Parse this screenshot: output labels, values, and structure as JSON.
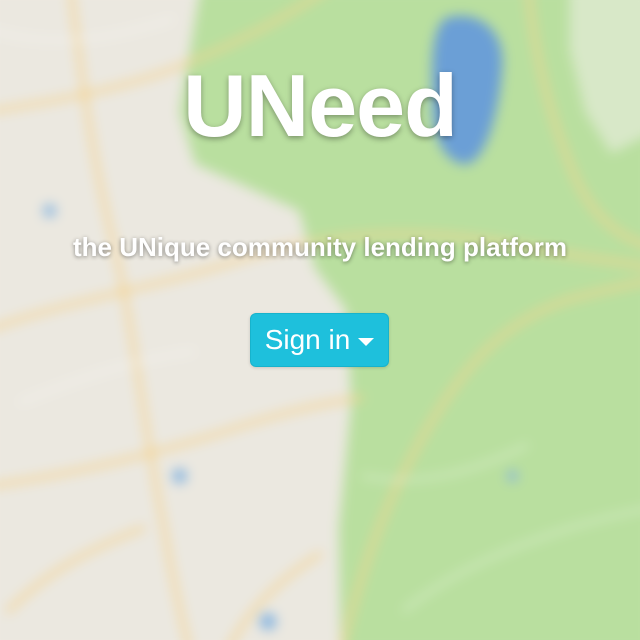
{
  "hero": {
    "brand": "UNeed",
    "tagline": "the UNique community lending platform",
    "signin_label": "Sign in",
    "signin_icon": "caret-down-icon"
  },
  "colors": {
    "button_bg": "#1ec0dc",
    "map_green": "#b9df9f",
    "map_land": "#ebe8e0",
    "map_water": "#6b9fd6",
    "map_road": "#f5d38e"
  }
}
